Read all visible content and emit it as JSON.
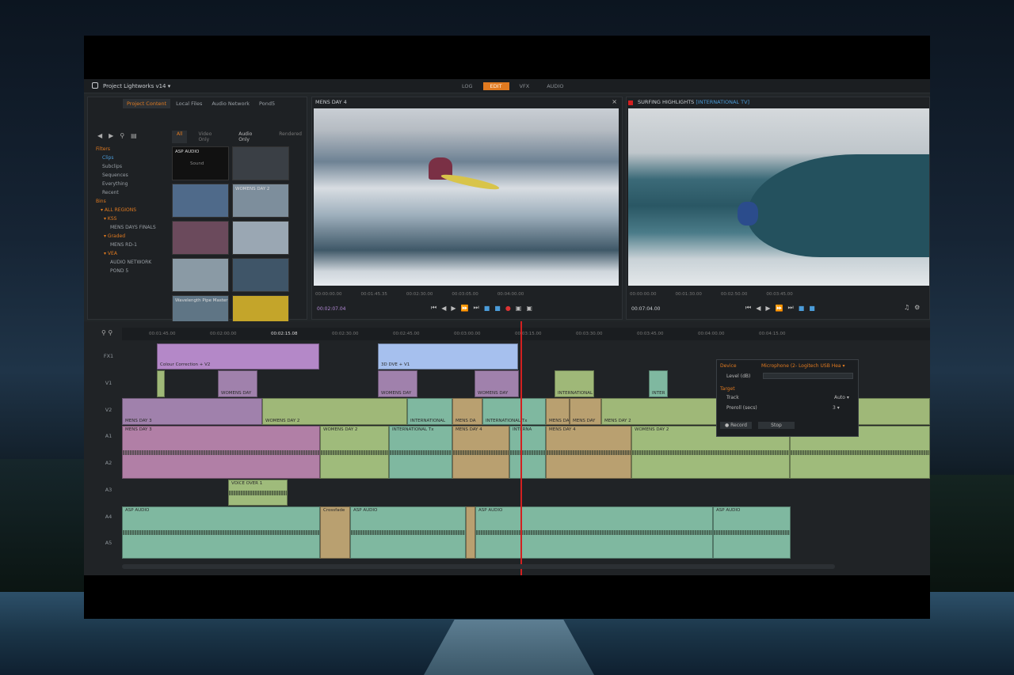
{
  "app": {
    "title": "Project Lightworks v14 ▾"
  },
  "modes": [
    "LOG",
    "EDIT",
    "VFX",
    "AUDIO"
  ],
  "active_mode": "EDIT",
  "browser": {
    "tabs": [
      "Project Content",
      "Local Files",
      "Audio Network",
      "Pond5"
    ],
    "subtabs": [
      "All",
      "Video Only",
      "Audio Only",
      "Rendered"
    ],
    "sidebar": [
      {
        "label": "Filters",
        "kind": "hdr"
      },
      {
        "label": "Clips",
        "kind": "sel"
      },
      {
        "label": "Subclips",
        "kind": ""
      },
      {
        "label": "Sequences",
        "kind": ""
      },
      {
        "label": "Everything",
        "kind": ""
      },
      {
        "label": "Recent",
        "kind": ""
      },
      {
        "label": "Bins",
        "kind": "hdr"
      },
      {
        "label": "▾ ALL REGIONS",
        "kind": "hdr"
      },
      {
        "label": "▾ KSS",
        "kind": "hdr"
      },
      {
        "label": "MENS DAYS FINALS",
        "kind": ""
      },
      {
        "label": "▾ Graded",
        "kind": "hdr"
      },
      {
        "label": "MENS RD-1",
        "kind": ""
      },
      {
        "label": "▾ VEA",
        "kind": "hdr"
      },
      {
        "label": "AUDIO NETWORK",
        "kind": ""
      },
      {
        "label": "POND 5",
        "kind": ""
      }
    ],
    "thumbs": [
      {
        "label": "ASP AUDIO",
        "sub": "Sound",
        "bg": "#111"
      },
      {
        "label": "",
        "sub": "",
        "bg": "#3a3f45"
      },
      {
        "label": "",
        "sub": "",
        "bg": "#4f6a8a"
      },
      {
        "label": "WOMENS DAY 2",
        "sub": "",
        "bg": "#7d8e9c"
      },
      {
        "label": "",
        "sub": "",
        "bg": "#6b4a5c"
      },
      {
        "label": "",
        "sub": "",
        "bg": "#9aa7b3"
      },
      {
        "label": "",
        "sub": "",
        "bg": "#8a9aa5"
      },
      {
        "label": "",
        "sub": "",
        "bg": "#3f5568"
      },
      {
        "label": "Wavelength Pipe Master",
        "sub": "",
        "bg": "#5f7585"
      },
      {
        "label": "",
        "sub": "",
        "bg": "#c4a52a"
      }
    ]
  },
  "source_viewer": {
    "title": "MENS DAY 4",
    "timecodes": [
      "00:00:00.00",
      "00:01:45.35",
      "00:02:30.00",
      "00:03:05.00",
      "00:04:00.00"
    ],
    "current_tc": "00:02:07.04"
  },
  "record_viewer": {
    "title": "SURFING HIGHLIGHTS",
    "title_tag": "[INTERNATIONAL TV]",
    "timecodes": [
      "00:00:00.00",
      "00:01:30.00",
      "00:02:50.00",
      "00:03:45.00"
    ],
    "current_tc": "00:07:04.00"
  },
  "timeline": {
    "ruler": [
      "00:01:45.00",
      "00:02:00.00",
      "00:02:15.08",
      "00:02:30.00",
      "00:02:45.00",
      "00:03:00.00",
      "00:03:15.00",
      "00:03:30.00",
      "00:03:45.00",
      "00:04:00.00",
      "00:04:15.00"
    ],
    "tracks": [
      "FX1",
      "V1",
      "V2",
      "A1",
      "A2",
      "A3",
      "A4",
      "A5"
    ],
    "clips": {
      "fx_colour": "Colour Correction + V2",
      "fx_3d": "3D DVE + V1",
      "v1_a": "WOMENS DAY",
      "v1_b": "WOMENS DAY",
      "v1_c": "WOMENS DAY",
      "v1_d": "INTERNATIONAL",
      "v1_e": "INTER",
      "v2_a": "MENS DAY 3",
      "v2_b": "WOMENS DAY 2",
      "v2_c": "INTERNATIONAL",
      "v2_d": "MENS DA",
      "v2_e": "INTERNATIONAL Tx",
      "v2_f": "MENS DAY",
      "v2_g": "MENS DAY",
      "v2_h": "MENS DAY 2",
      "v2_i": "WOMENS DAY 2",
      "a_mens3": "MENS DAY 3",
      "a_womens": "WOMENS DAY 2",
      "a_intl": "INTERNATIONAL Tx",
      "a_mens4": "MENS DAY 4",
      "a_interna": "INTERNA",
      "a_womens2": "WOMENS DAY 2",
      "a3": "VOICE OVER 1",
      "a4_asp": "ASP AUDIO",
      "crossfade": "Crossfade"
    }
  },
  "audio_popup": {
    "device_label": "Device",
    "device_value": "Microphone (2- Logitech USB Hea ▾",
    "level_label": "Level (dB)",
    "target_label": "Target",
    "track_label": "Track",
    "track_value": "Auto ▾",
    "preroll_label": "Preroll (secs)",
    "preroll_value": "3 ▾",
    "record_btn": "● Record",
    "stop_btn": "Stop"
  },
  "colors": {
    "accent": "#e07a20",
    "fx_purple": "#b488c8",
    "fx_blue": "#a6c0ee",
    "video_purple": "#a081ac",
    "video_green": "#9fb878",
    "audio_pink": "#b17fa6",
    "audio_green": "#9fbb7b",
    "audio_teal": "#7fb8a0",
    "audio_tan": "#b9a070",
    "playhead": "#d32020"
  }
}
